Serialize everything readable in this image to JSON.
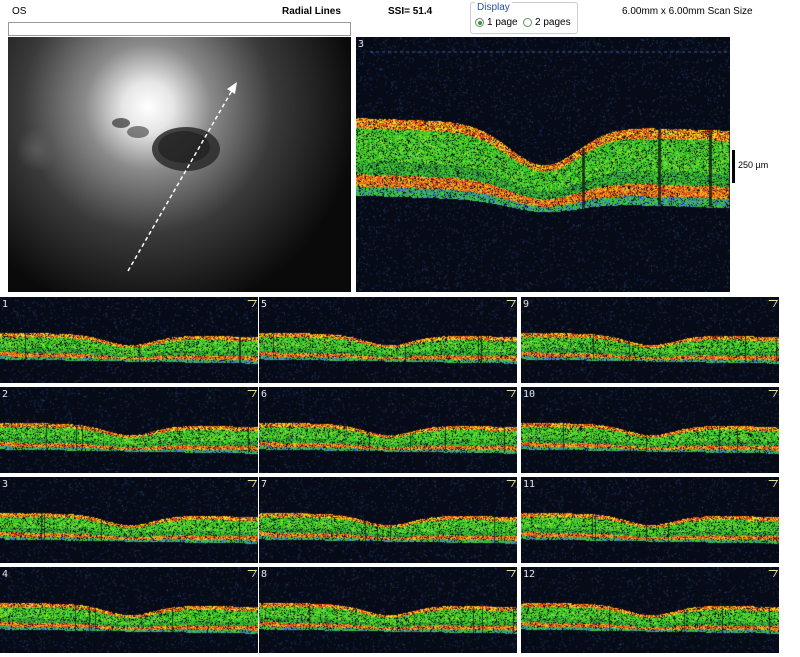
{
  "header": {
    "eye": "OS",
    "scan_type": "Radial Lines",
    "ssi": "SSI= 51.4",
    "scan_size": "6.00mm x 6.00mm Scan Size"
  },
  "display": {
    "legend": "Display",
    "options": [
      {
        "label": "1 page",
        "selected": true
      },
      {
        "label": "2 pages",
        "selected": false
      }
    ]
  },
  "main_scan": {
    "number": "3",
    "scale_label": "250 µm"
  },
  "thumbnails": [
    "1",
    "5",
    "9",
    "2",
    "6",
    "10",
    "3",
    "7",
    "11",
    "4",
    "8",
    "12"
  ],
  "colors": {
    "background": "#070b18",
    "layer_green": "#3ccf2a",
    "layer_yellow": "#e8e020",
    "layer_red": "#e04818",
    "speckle_blue": "#3d6fd0"
  }
}
